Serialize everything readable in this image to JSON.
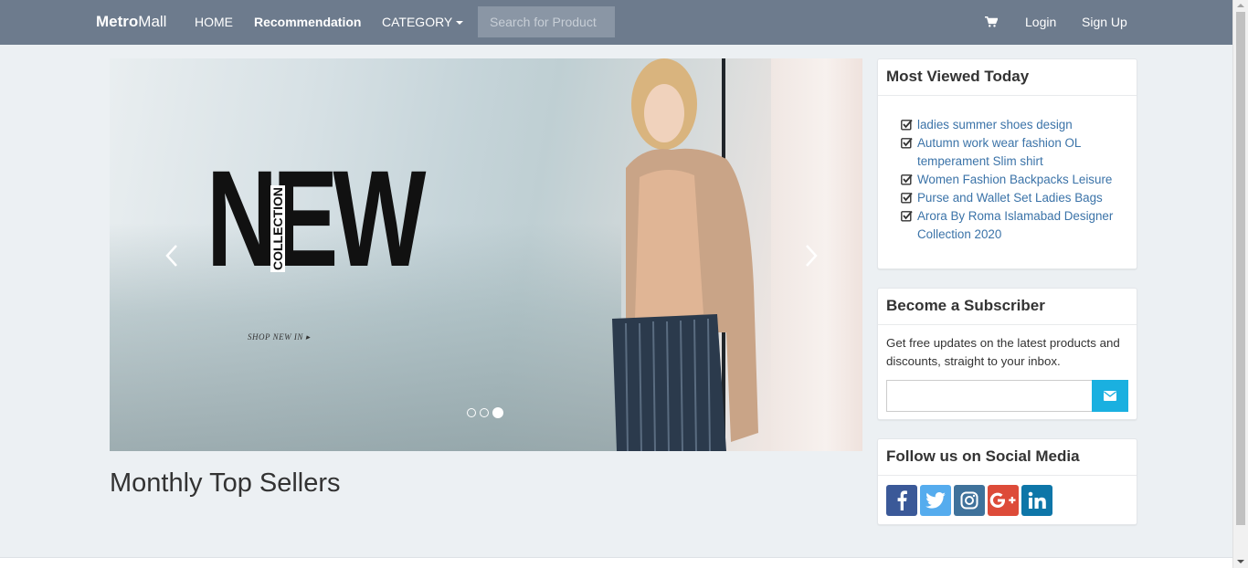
{
  "navbar": {
    "brand_bold": "Metro",
    "brand_rest": "Mall",
    "home": "HOME",
    "recommendation": "Recommendation",
    "category": "CATEGORY",
    "search_placeholder": "Search for Product",
    "login": "Login",
    "signup": "Sign Up",
    "cart_icon": "shopping-cart-icon"
  },
  "carousel": {
    "headline": "NEW",
    "sub_headline": "COLLECTION",
    "cta": "SHOP NEW IN ▸",
    "slide_count": 3,
    "active_slide": 3
  },
  "main": {
    "section_title": "Monthly Top Sellers"
  },
  "most_viewed": {
    "title": "Most Viewed Today",
    "items": [
      "ladies summer shoes design",
      "Autumn work wear fashion OL temperament Slim shirt",
      "Women Fashion Backpacks Leisure",
      "Purse and Wallet Set Ladies Bags",
      "Arora By Roma Islamabad Designer Collection 2020"
    ]
  },
  "subscriber": {
    "title": "Become a Subscriber",
    "text": "Get free updates on the latest products and discounts, straight to your inbox.",
    "input_value": "",
    "button_icon": "envelope-icon"
  },
  "social": {
    "title": "Follow us on Social Media",
    "networks": [
      {
        "name": "facebook",
        "color": "#3b5998"
      },
      {
        "name": "twitter",
        "color": "#55acee"
      },
      {
        "name": "instagram",
        "color": "#3f729b"
      },
      {
        "name": "google-plus",
        "color": "#dd4b39"
      },
      {
        "name": "linkedin",
        "color": "#0e76a8"
      }
    ]
  },
  "colors": {
    "navbar": "#6d7b8d",
    "link": "#3b73a8",
    "subscribe_button": "#1ab0e0",
    "background": "#ecf0f3"
  }
}
